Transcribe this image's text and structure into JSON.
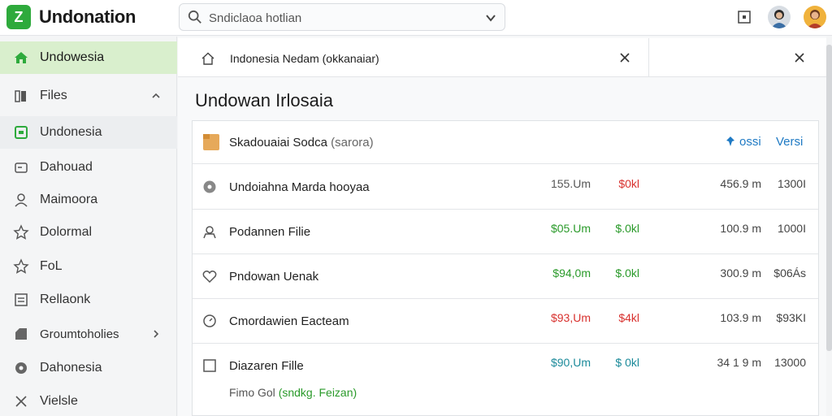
{
  "app": {
    "title": "Undonation",
    "logo_glyph": "Z"
  },
  "search": {
    "placeholder": "Sndiclaoa hotlian"
  },
  "sidebar": {
    "items": [
      {
        "label": "Undowesia",
        "icon": "home-icon"
      },
      {
        "label": "Files",
        "icon": "files-icon"
      },
      {
        "label": "Undonesia",
        "icon": "folder-green-icon"
      },
      {
        "label": "Dahouad",
        "icon": "dashboard-icon"
      },
      {
        "label": "Maimoora",
        "icon": "user-icon"
      },
      {
        "label": "Dolormal",
        "icon": "star-icon"
      },
      {
        "label": "FoL",
        "icon": "star-icon"
      },
      {
        "label": "Rellaonk",
        "icon": "grid-icon"
      },
      {
        "label": "Groumtoholies",
        "icon": "tag-icon"
      },
      {
        "label": "Dahonesia",
        "icon": "circle-icon"
      },
      {
        "label": "Vielsle",
        "icon": "wrench-icon"
      }
    ]
  },
  "tabs": [
    {
      "label": "Indonesia Nedam (okkanaiar)"
    },
    {
      "label": ""
    }
  ],
  "page": {
    "title": "Undowan Irlosaia"
  },
  "panel": {
    "header": {
      "label": "Skadouaiai Sodca",
      "tag": "(sarora)",
      "action_pin": "ossi",
      "action_version": "Versi"
    },
    "rows": [
      {
        "name": "Undoiahna Marda hooyaa",
        "c1": "155.Um",
        "c2": "$0kl",
        "c3": "456.9 m",
        "c4": "1300I"
      },
      {
        "name": "Podannen Filie",
        "c1": "$05.Um",
        "c2": "$.0kl",
        "c3": "100.9 m",
        "c4": "1000I"
      },
      {
        "name": "Pndowan Uenak",
        "c1": "$94,0m",
        "c2": "$.0kl",
        "c3": "300.9 m",
        "c4": "$06Ás"
      },
      {
        "name": "Cmordawien Eacteam",
        "c1": "$93,Um",
        "c2": "$4kl",
        "c3": "103.9 m",
        "c4": "$93KI"
      },
      {
        "name": "Diazaren Fille",
        "sub_prefix": "Fimo Gol",
        "sub_tag": "(sndkg. Feizan)",
        "c1": "$90,Um",
        "c2": "$ 0kl",
        "c3": "34 1 9 m",
        "c4": "13000"
      }
    ]
  },
  "colors": {
    "accent": "#2eaa3c",
    "active_bg": "#d9efcd",
    "link": "#1f7ac4",
    "positive": "#2a9a2a",
    "negative": "#d8312e",
    "teal": "#1b8a9a"
  }
}
